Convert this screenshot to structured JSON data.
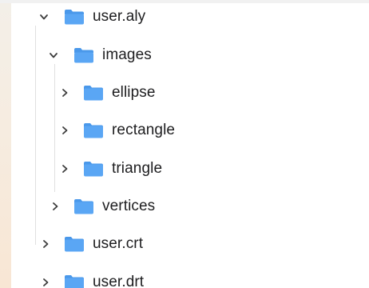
{
  "colors": {
    "folder": "#5aa6f4",
    "folder_tab": "#4a98ea",
    "chevron": "#3c3c3c",
    "text": "#1d1d1f",
    "guide": "#e0e0e0"
  },
  "tree": {
    "user_aly": {
      "label": "user.aly",
      "expanded": true,
      "icon": "folder-open-icon"
    },
    "images": {
      "label": "images",
      "expanded": true,
      "icon": "folder-open-icon"
    },
    "ellipse": {
      "label": "ellipse",
      "expanded": false,
      "icon": "folder-icon"
    },
    "rectangle": {
      "label": "rectangle",
      "expanded": false,
      "icon": "folder-icon"
    },
    "triangle": {
      "label": "triangle",
      "expanded": false,
      "icon": "folder-icon"
    },
    "vertices": {
      "label": "vertices",
      "expanded": false,
      "icon": "folder-icon"
    },
    "user_crt": {
      "label": "user.crt",
      "expanded": false,
      "icon": "folder-icon"
    },
    "user_drt": {
      "label": "user.drt",
      "expanded": false,
      "icon": "folder-icon"
    }
  }
}
